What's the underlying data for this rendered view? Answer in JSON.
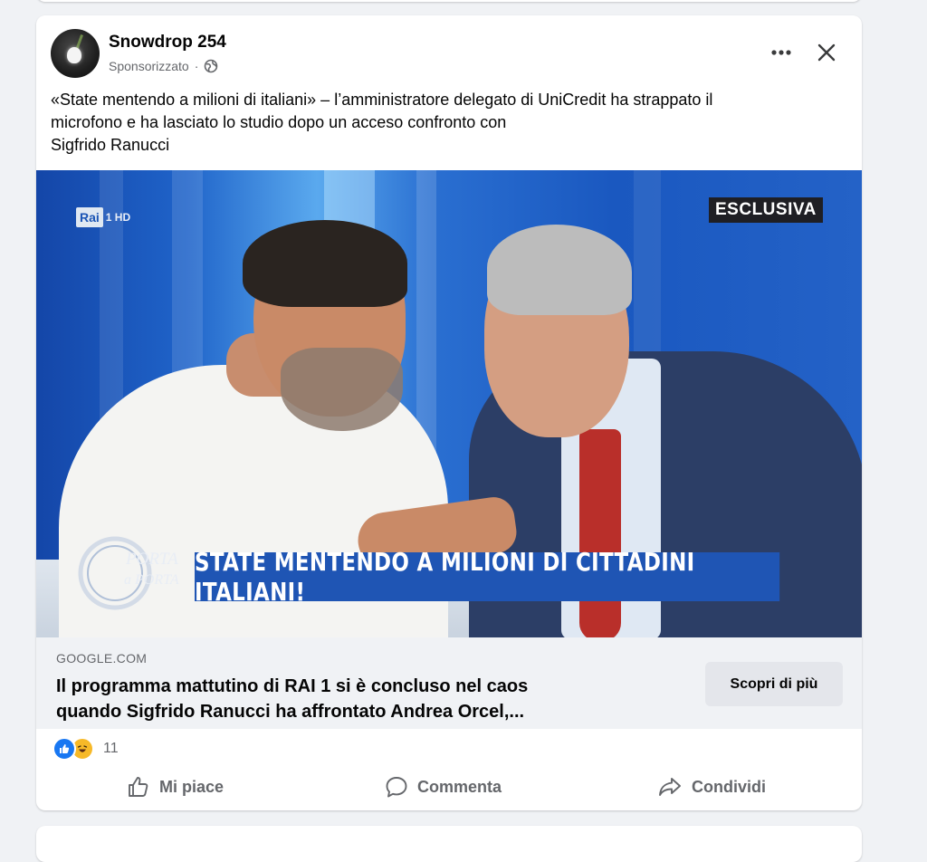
{
  "post": {
    "author": "Snowdrop 254",
    "sponsored_label": "Sponsorizzato",
    "separator": "·",
    "text_lines": [
      "«State mentendo a milioni di italiani» – l’amministratore delegato di UniCredit ha strappato il",
      "microfono e ha lasciato lo studio dopo un acceso confronto con",
      "Sigfrido Ranucci"
    ],
    "more_icon": "more-horizontal-icon",
    "close_icon": "close-icon",
    "privacy_icon": "globe-icon"
  },
  "media": {
    "channel_logo": "Rai",
    "channel_suffix": "1 HD",
    "exclusive_label": "ESCLUSIVA",
    "show_logo_line1": "PORTA",
    "show_logo_line2": "a PORTA",
    "banner_text": "STATE MENTENDO A MILIONI DI CITTADINI ITALIANI!"
  },
  "link": {
    "domain": "GOOGLE.COM",
    "title_lines": [
      "Il programma mattutino di RAI 1 si è concluso nel caos",
      "quando Sigfrido Ranucci ha affrontato Andrea Orcel,..."
    ],
    "cta_label": "Scopri di più"
  },
  "reactions": {
    "types": [
      "like",
      "haha"
    ],
    "count": "11"
  },
  "actions": {
    "like_label": "Mi piace",
    "comment_label": "Commenta",
    "share_label": "Condividi",
    "like_icon": "thumbs-up-icon",
    "comment_icon": "comment-bubble-icon",
    "share_icon": "share-arrow-icon"
  },
  "colors": {
    "facebook_blue": "#1877f2",
    "banner_blue": "#1f55b4",
    "secondary_text": "#65676b",
    "feed_background": "#f0f2f5"
  }
}
